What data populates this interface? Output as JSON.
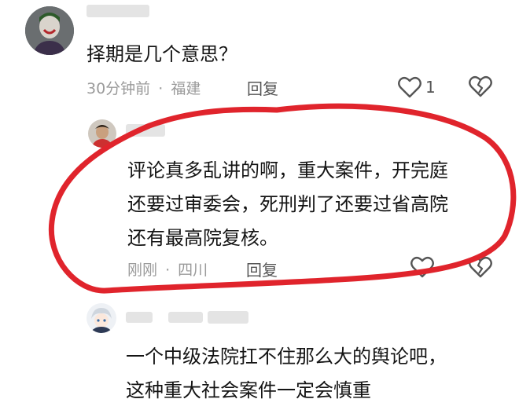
{
  "comment1": {
    "text": "择期是几个意思？",
    "time": "30分钟前",
    "location": "福建",
    "reply_label": "回复",
    "like_count": "1",
    "like_icon": "heart-outline-icon",
    "dislike_icon": "broken-heart-icon"
  },
  "comment2": {
    "lines": [
      "评论真多乱讲的啊，重大案件，开完庭",
      "还要过审委会，死刑判了还要过省高院",
      "还有最高院复核。"
    ],
    "time": "刚刚",
    "location": "四川",
    "reply_label": "回复",
    "like_icon": "heart-outline-icon",
    "dislike_icon": "broken-heart-icon"
  },
  "comment3": {
    "lines": [
      "一个中级法院扛不住那么大的舆论吧，",
      "这种重大社会案件一定会慎重"
    ]
  },
  "meta_separator": "·",
  "colors": {
    "highlight_circle": "#e0242c",
    "meta_text": "#9a9a9a",
    "icon_stroke": "#555555"
  }
}
